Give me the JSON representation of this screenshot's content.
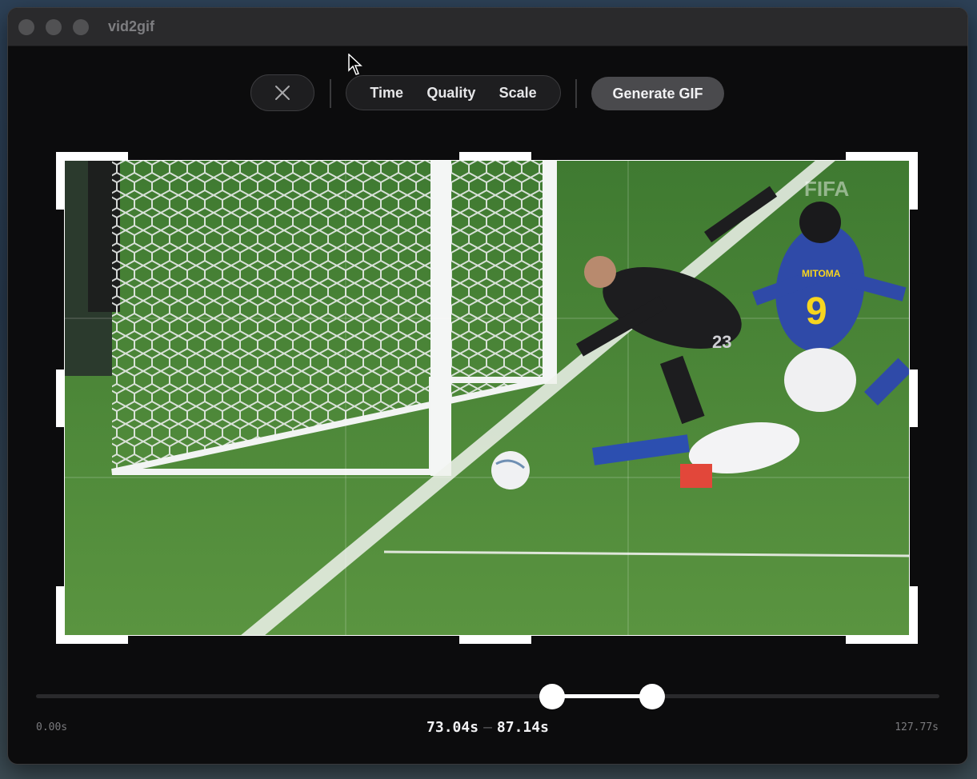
{
  "app": {
    "title": "vid2gif"
  },
  "toolbar": {
    "close_icon": "close-icon",
    "tabs": [
      "Time",
      "Quality",
      "Scale"
    ],
    "generate_label": "Generate GIF"
  },
  "video": {
    "watermark": "FIFA",
    "jersey_number": "9",
    "jersey_name": "MITOMA",
    "keeper_number": "23"
  },
  "timeline": {
    "start_label": "0.00s",
    "end_label": "127.77s",
    "sel_start": "73.04s",
    "sel_sep": "–",
    "sel_end": "87.14s",
    "duration": 127.77,
    "range_start": 73.04,
    "range_end": 87.14
  },
  "colors": {
    "window_bg": "#0c0c0d",
    "accent": "#ffffff",
    "pitch": "#4f8a3a"
  }
}
